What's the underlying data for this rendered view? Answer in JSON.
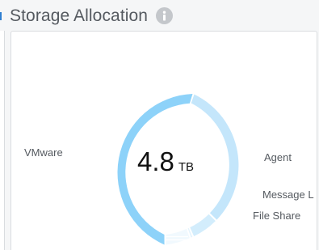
{
  "header": {
    "title": "Storage Allocation",
    "info_icon": "info-icon"
  },
  "center": {
    "value": "4.8",
    "unit": "TB"
  },
  "segment_labels": {
    "vmware": "VMware",
    "agent": "Agent",
    "message": "Message L",
    "file_share": "File Share"
  },
  "colors": {
    "vmware": "#8dd2f9",
    "agent": "#c4e6fb",
    "message": "#d3edfc",
    "file_share": "#e4f4fd",
    "other": "#f1f9fe",
    "title_text": "#555a60",
    "info_icon_bg": "#c4c7cb",
    "accent_tick": "#2f7fd1"
  }
}
